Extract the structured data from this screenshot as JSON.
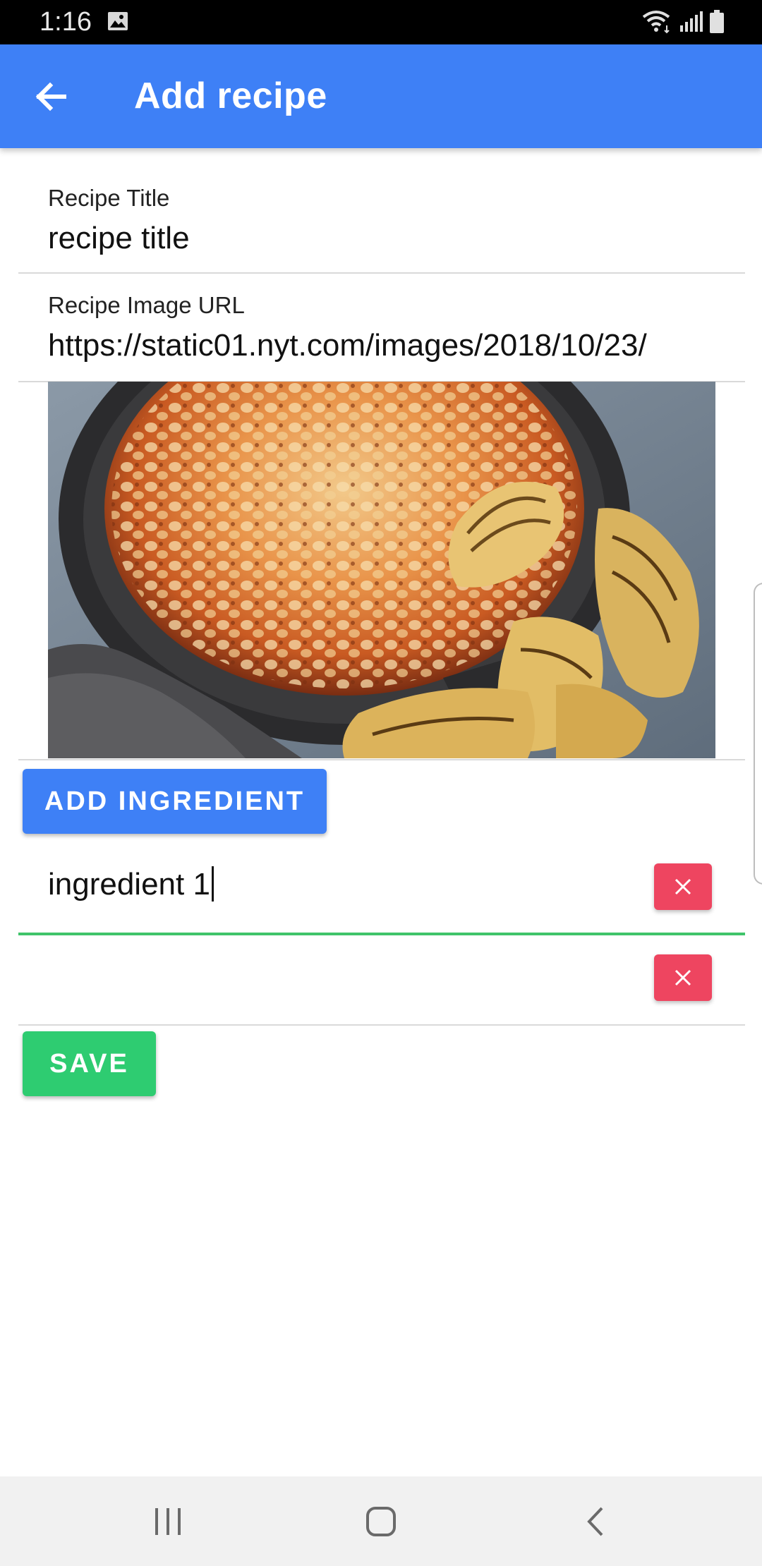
{
  "status_bar": {
    "time": "1:16",
    "icons": [
      "image-icon",
      "wifi-icon",
      "signal-icon",
      "battery-icon"
    ]
  },
  "app_bar": {
    "title": "Add recipe",
    "back_icon": "arrow-left-icon",
    "background_color": "#3e80f6"
  },
  "form": {
    "title_field": {
      "label": "Recipe Title",
      "value": "recipe title"
    },
    "image_url_field": {
      "label": "Recipe Image URL",
      "value": "https://static01.nyt.com/images/2018/10/23/"
    },
    "image_preview": {
      "alt": "baked beans in a cast iron skillet with grilled bread"
    }
  },
  "add_ingredient_button": {
    "label": "ADD INGREDIENT",
    "color": "#3e80f6"
  },
  "ingredients": [
    {
      "value": "ingredient 1",
      "focused": true,
      "remove_icon": "close-icon"
    },
    {
      "value": "",
      "focused": false,
      "remove_icon": "close-icon"
    }
  ],
  "save_button": {
    "label": "SAVE",
    "color": "#2ecc71"
  },
  "colors": {
    "remove_button": "#ee4560",
    "focused_underline": "#3fc46a"
  },
  "nav_bar": {
    "buttons": [
      "recent-apps-icon",
      "home-icon",
      "back-icon"
    ]
  }
}
